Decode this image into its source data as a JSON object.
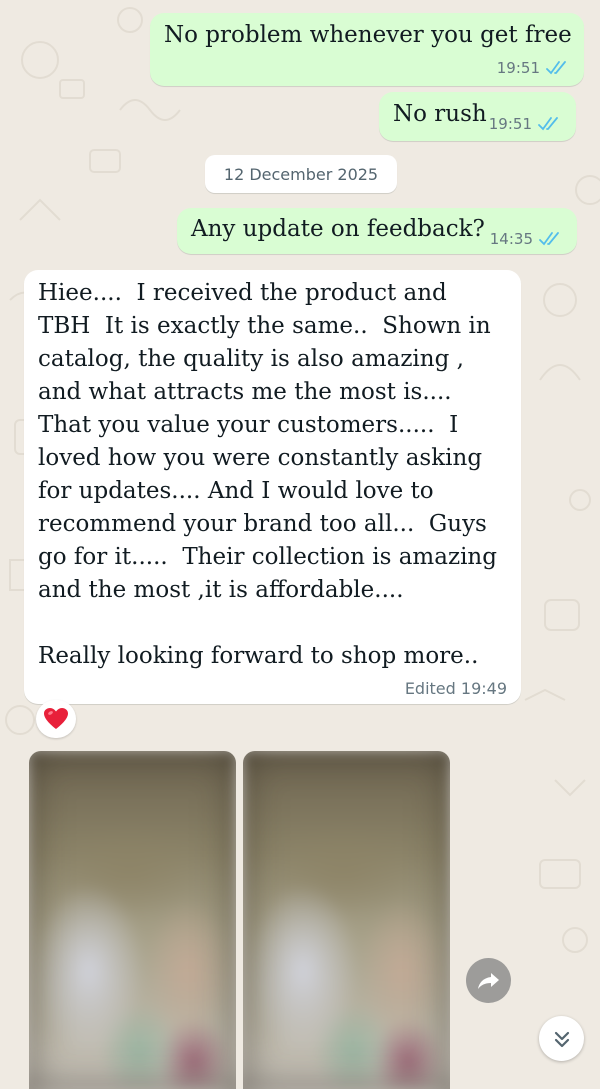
{
  "messages": [
    {
      "text": "No problem whenever you get free",
      "time": "19:51",
      "direction": "outgoing",
      "status": "read"
    },
    {
      "text": "No rush",
      "time": "19:51",
      "direction": "outgoing",
      "status": "read"
    },
    {
      "text": "Any update on feedback?",
      "time": "14:35",
      "direction": "outgoing",
      "status": "read"
    },
    {
      "text": "Hiee....  I received the product and TBH  It is exactly the same..  Shown in catalog, the quality is also amazing , and what attracts me the most is.... That you value your customers.....  I loved how you were constantly asking for updates.... And I would love to recommend your brand too all...  Guys go for it.....  Their collection is amazing and the most ,it is affordable....\n\nReally looking forward to shop more..",
      "time": "Edited 19:49",
      "direction": "incoming"
    }
  ],
  "date_separator": "12 December 2025",
  "reaction": {
    "emoji": "❤️"
  },
  "media": {
    "count": 2,
    "blurred": true
  },
  "icons": {
    "forward": "forward-icon",
    "scroll_down": "double-chevron-down-icon",
    "read_ticks": "double-check-icon"
  },
  "colors": {
    "outgoing_bubble": "#d9fdd3",
    "incoming_bubble": "#ffffff",
    "background": "#efeae2",
    "read_tick": "#53bdeb",
    "meta_text": "#667781"
  }
}
